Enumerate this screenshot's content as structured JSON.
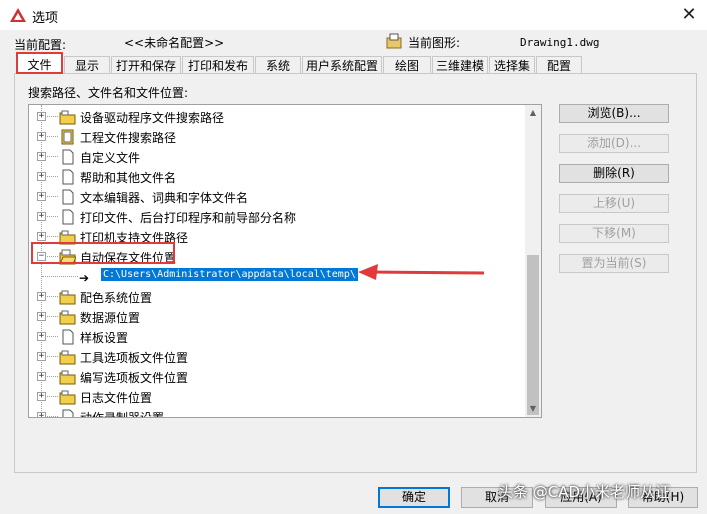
{
  "window": {
    "title": "选项",
    "close_glyph": "✕"
  },
  "profile": {
    "current_profile_label": "当前配置:",
    "current_profile_value": "<<未命名配置>>",
    "current_drawing_label": "当前图形:",
    "current_drawing_value": "Drawing1.dwg"
  },
  "tabs": [
    {
      "label": "文件",
      "active": true
    },
    {
      "label": "显示"
    },
    {
      "label": "打开和保存"
    },
    {
      "label": "打印和发布"
    },
    {
      "label": "系统"
    },
    {
      "label": "用户系统配置"
    },
    {
      "label": "绘图"
    },
    {
      "label": "三维建模"
    },
    {
      "label": "选择集"
    },
    {
      "label": "配置"
    }
  ],
  "search_paths_label": "搜索路径、文件名和文件位置:",
  "tree": {
    "items": [
      {
        "label": "设备驱动程序文件搜索路径",
        "icon": "folder-icon",
        "expander": "+"
      },
      {
        "label": "工程文件搜索路径",
        "icon": "project-icon",
        "expander": "+"
      },
      {
        "label": "自定义文件",
        "icon": "file-icon",
        "expander": "+"
      },
      {
        "label": "帮助和其他文件名",
        "icon": "file-icon",
        "expander": "+"
      },
      {
        "label": "文本编辑器、词典和字体文件名",
        "icon": "file-icon",
        "expander": "+"
      },
      {
        "label": "打印文件、后台打印程序和前导部分名称",
        "icon": "file-icon",
        "expander": "+"
      },
      {
        "label": "打印机支持文件路径",
        "icon": "folder-icon",
        "expander": "+"
      },
      {
        "label": "自动保存文件位置",
        "icon": "folder-open-icon",
        "expander": "−"
      },
      {
        "label": "配色系统位置",
        "icon": "folder-icon",
        "expander": "+"
      },
      {
        "label": "数据源位置",
        "icon": "folder-icon",
        "expander": "+"
      },
      {
        "label": "样板设置",
        "icon": "file-icon",
        "expander": "+"
      },
      {
        "label": "工具选项板文件位置",
        "icon": "folder-icon",
        "expander": "+"
      },
      {
        "label": "编写选项板文件位置",
        "icon": "folder-icon",
        "expander": "+"
      },
      {
        "label": "日志文件位置",
        "icon": "folder-icon",
        "expander": "+"
      },
      {
        "label": "动作录制器设置",
        "icon": "file-icon",
        "expander": "+"
      }
    ],
    "selected_child_path": "C:\\Users\\Administrator\\appdata\\local\\temp\\"
  },
  "side_buttons": {
    "browse": "浏览(B)...",
    "add": "添加(D)...",
    "remove": "删除(R)",
    "move_up": "上移(U)",
    "move_down": "下移(M)",
    "set_current": "置为当前(S)"
  },
  "bottom_buttons": {
    "ok": "确定",
    "cancel": "取消",
    "apply": "应用(A)",
    "help": "帮助(H)"
  },
  "watermark": "头条 @CAD小米老师从证",
  "colors": {
    "accent": "#0078d7",
    "annotation": "#e03a3a"
  }
}
